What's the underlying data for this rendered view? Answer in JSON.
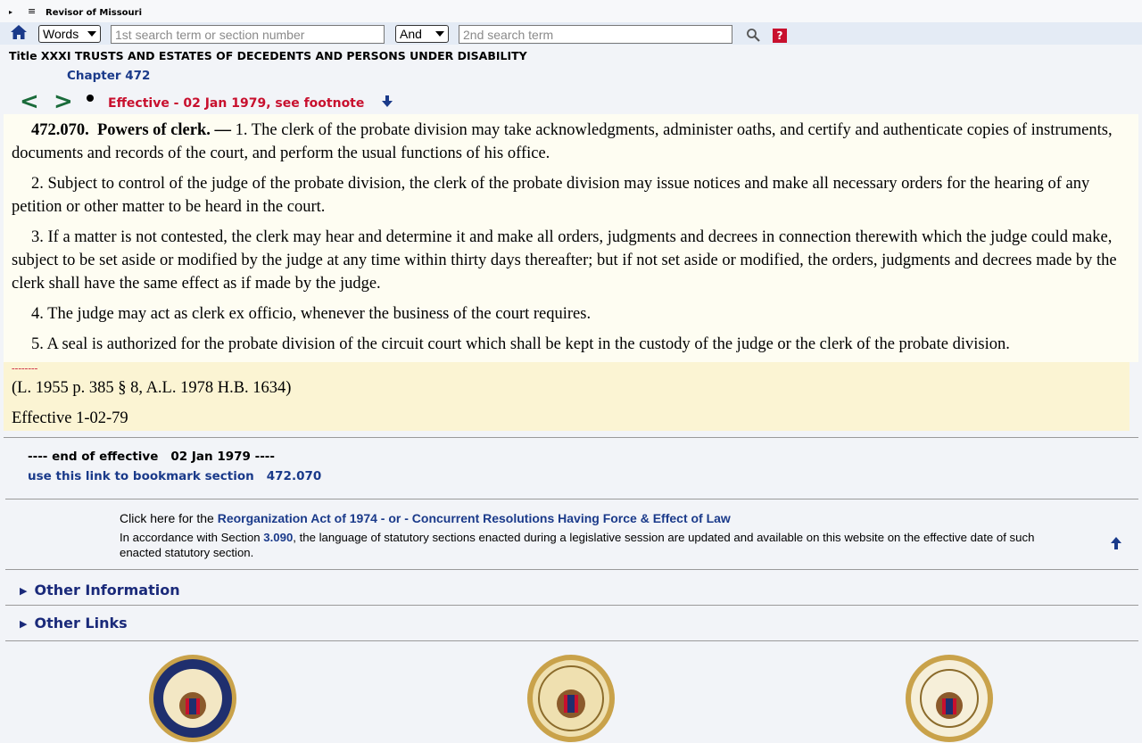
{
  "topbar": {
    "toggle_glyph": "▸",
    "menu_glyph": "≡",
    "brand": "Revisor of Missouri"
  },
  "search": {
    "mode_value": "Words",
    "term1_placeholder": "1st search term or section number",
    "operator_value": "And",
    "term2_placeholder": "2nd search term",
    "help_label": "?"
  },
  "header": {
    "title": "Title XXXI TRUSTS AND ESTATES OF DECEDENTS AND PERSONS UNDER DISABILITY",
    "chapter": "Chapter 472",
    "prev": "<",
    "next": ">",
    "effective_notice": "Effective - 02 Jan 1979, see footnote"
  },
  "section": {
    "number": "472.070.",
    "heading": "Powers of clerk. —",
    "p1": " 1.  The clerk of the probate division may take acknowledgments, administer oaths, and certify and authenticate copies of instruments, documents and records of the court, and perform the usual functions of his office.",
    "p2": "2.  Subject to control of the judge of the probate division, the clerk of the probate division may issue notices and make all necessary orders for the hearing of any petition or other matter to be heard in the court.",
    "p3": "3.  If a matter is not contested, the clerk may hear and determine it and make all orders, judgments and decrees in connection therewith which the judge could make, subject to be set aside or modified by the judge at any time within thirty days thereafter; but if not set aside or modified, the orders, judgments and decrees made by the clerk shall have the same effect as if made by the judge.",
    "p4": "4.  The judge may act as clerk ex officio, whenever the business of the court requires.",
    "p5": "5.  A seal is authorized for the probate division of the circuit court which shall be kept in the custody of the judge or the clerk of the probate division."
  },
  "history": {
    "dashes": "--------",
    "source": "(L. 1955 p. 385 § 8, A.L. 1978 H.B. 1634)",
    "effective": "Effective 1-02-79"
  },
  "footer": {
    "end_label": "---- end of effective",
    "end_date": "02 Jan 1979 ----",
    "bookmark_label": "use this link to bookmark section",
    "bookmark_section": "472.070",
    "reorg_prefix": "Click here for the ",
    "reorg_link": "Reorganization Act of 1974 - or - Concurrent Resolutions Having Force & Effect of Law",
    "accord_prefix": "In accordance with Section ",
    "accord_link": "3.090",
    "accord_suffix": ", the language of statutory sections enacted during a legislative session are updated and available on this website on the effective date of such enacted statutory section.",
    "other_information": "Other Information",
    "other_links": "Other Links"
  },
  "colors": {
    "nav_arrow": "#1a6b3a",
    "effective_red": "#c8102e",
    "link_blue": "#1a3a8a",
    "body_bg": "#fefdf2",
    "history_bg": "#fbf4d3"
  }
}
